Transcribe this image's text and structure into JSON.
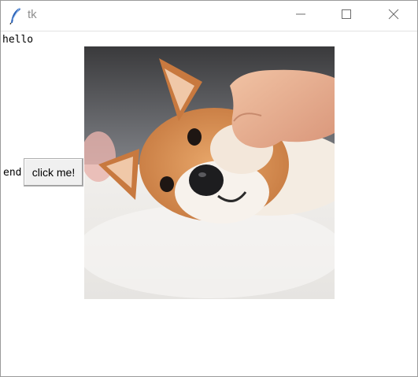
{
  "window": {
    "title": "tk",
    "controls": {
      "minimize": "minimize-icon",
      "maximize": "maximize-icon",
      "close": "close-icon"
    }
  },
  "content": {
    "label_top": "hello",
    "label_side": "end",
    "button_label": "click me!",
    "image_subject": "shiba-inu-dog-photo"
  },
  "colors": {
    "title_text": "#8f8f8f",
    "button_face": "#f0f0f0",
    "background": "#ffffff"
  }
}
